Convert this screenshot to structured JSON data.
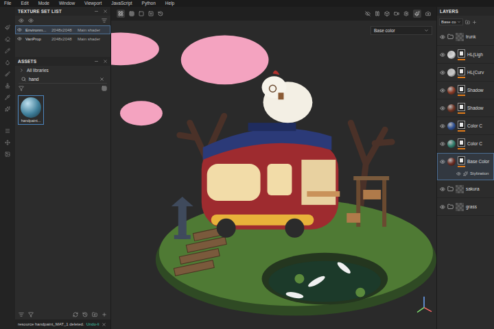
{
  "menu": [
    "File",
    "Edit",
    "Mode",
    "Window",
    "Viewport",
    "JavaScript",
    "Python",
    "Help"
  ],
  "texture_set_list": {
    "title": "TEXTURE SET LIST",
    "rows": [
      {
        "name": "Environm...",
        "size": "2048x2048",
        "shader": "Main shader",
        "visible": true,
        "selected": true
      },
      {
        "name": "VanProp",
        "size": "2048x2048",
        "shader": "Main shader",
        "visible": true,
        "selected": false
      }
    ]
  },
  "assets": {
    "title": "ASSETS",
    "library": "All libraries",
    "search": "hand",
    "items": [
      {
        "label": "handpaint...",
        "selected": true
      }
    ]
  },
  "viewport": {
    "channel": "Base color"
  },
  "layers": {
    "title": "LAYERS",
    "channel": "Base co",
    "rows": [
      {
        "name": "trunk",
        "kind": "folder",
        "visible": true,
        "selected": false
      },
      {
        "name": "HL(Ligh",
        "kind": "layer",
        "color": "#d8d8d8",
        "visible": true,
        "selected": false
      },
      {
        "name": "HL(Curv",
        "kind": "layer",
        "color": "#c8c8c8",
        "visible": true,
        "selected": false
      },
      {
        "name": "Shadow",
        "kind": "layer",
        "color": "#8a3b26",
        "visible": true,
        "selected": false
      },
      {
        "name": "Shadow",
        "kind": "layer",
        "color": "#6e3322",
        "visible": true,
        "selected": false
      },
      {
        "name": "Color C",
        "kind": "layer",
        "color": "#2d4f92",
        "visible": true,
        "selected": false
      },
      {
        "name": "Color C",
        "kind": "layer",
        "color": "#2f7d6c",
        "visible": true,
        "selected": false
      },
      {
        "name": "Base Color",
        "kind": "layer",
        "color": "#6a2c22",
        "visible": true,
        "selected": true,
        "effects": [
          {
            "name": "Stylization",
            "visible": true
          }
        ]
      },
      {
        "name": "sakura",
        "kind": "folder",
        "visible": true,
        "selected": false
      },
      {
        "name": "grass",
        "kind": "folder",
        "visible": true,
        "selected": false
      }
    ]
  },
  "status_bar": {
    "message": "resource handpaint_MAT_1 deleted.",
    "link": "Undo-li"
  }
}
